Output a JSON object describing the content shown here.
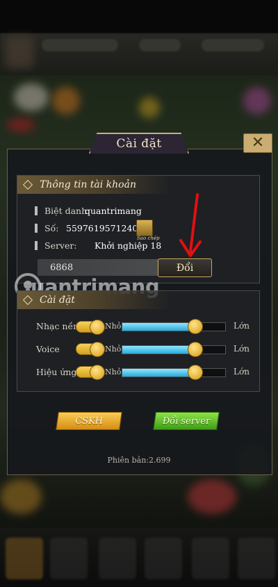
{
  "dialog": {
    "title": "Cài đặt",
    "close_glyph": "✕"
  },
  "account": {
    "heading": "Thông tin tài khoản",
    "nickname_label": "Biệt danh:",
    "nickname_value": "quantrimang",
    "number_label": "Số:",
    "number_value": "559761957124097",
    "copy_label": "Sao chép",
    "server_label": "Server:",
    "server_value": "Khởi nghiệp 18",
    "code_value": "6868",
    "change_button": "Đổi"
  },
  "settings": {
    "heading": "Cài đặt",
    "rows": [
      {
        "label": "Nhạc nền",
        "min": "Nhỏ",
        "max": "Lớn",
        "toggle_on": true,
        "level": 0.7
      },
      {
        "label": "Voice",
        "min": "Nhỏ",
        "max": "Lớn",
        "toggle_on": true,
        "level": 0.7
      },
      {
        "label": "Hiệu ứng",
        "min": "Nhỏ",
        "max": "Lớn",
        "toggle_on": true,
        "level": 0.7
      }
    ]
  },
  "buttons": {
    "cskh": "CSKH",
    "switch_server": "Đổi server"
  },
  "version": "Phiên bản:2.699",
  "watermark": "uantrimang",
  "colors": {
    "accent_gold": "#c9a85c",
    "slider_blue": "#2aa9d8",
    "green_button": "#3f9d14",
    "orange_button": "#d68c14",
    "annotation_red": "#e01010"
  }
}
